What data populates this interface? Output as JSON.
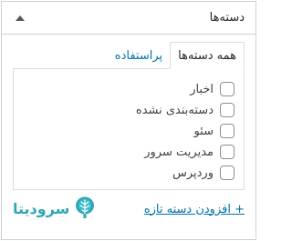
{
  "box": {
    "title": "دسته‌ها"
  },
  "tabs": [
    {
      "label": "همه دسته‌ها",
      "active": true
    },
    {
      "label": "پراستفاده",
      "active": false
    }
  ],
  "categories": [
    {
      "label": "اخبار",
      "checked": false
    },
    {
      "label": "دسته‌بندی نشده",
      "checked": false
    },
    {
      "label": "سئو",
      "checked": false
    },
    {
      "label": "مدیریت سرور",
      "checked": false
    },
    {
      "label": "وردپرس",
      "checked": false
    }
  ],
  "add_new": "+ افزودن دسته تازه",
  "watermark": {
    "text": "سرودیتا",
    "color": "#2fa7b5",
    "icon": "tree-icon"
  },
  "colors": {
    "link": "#0073aa",
    "border": "#ccd0d4"
  }
}
